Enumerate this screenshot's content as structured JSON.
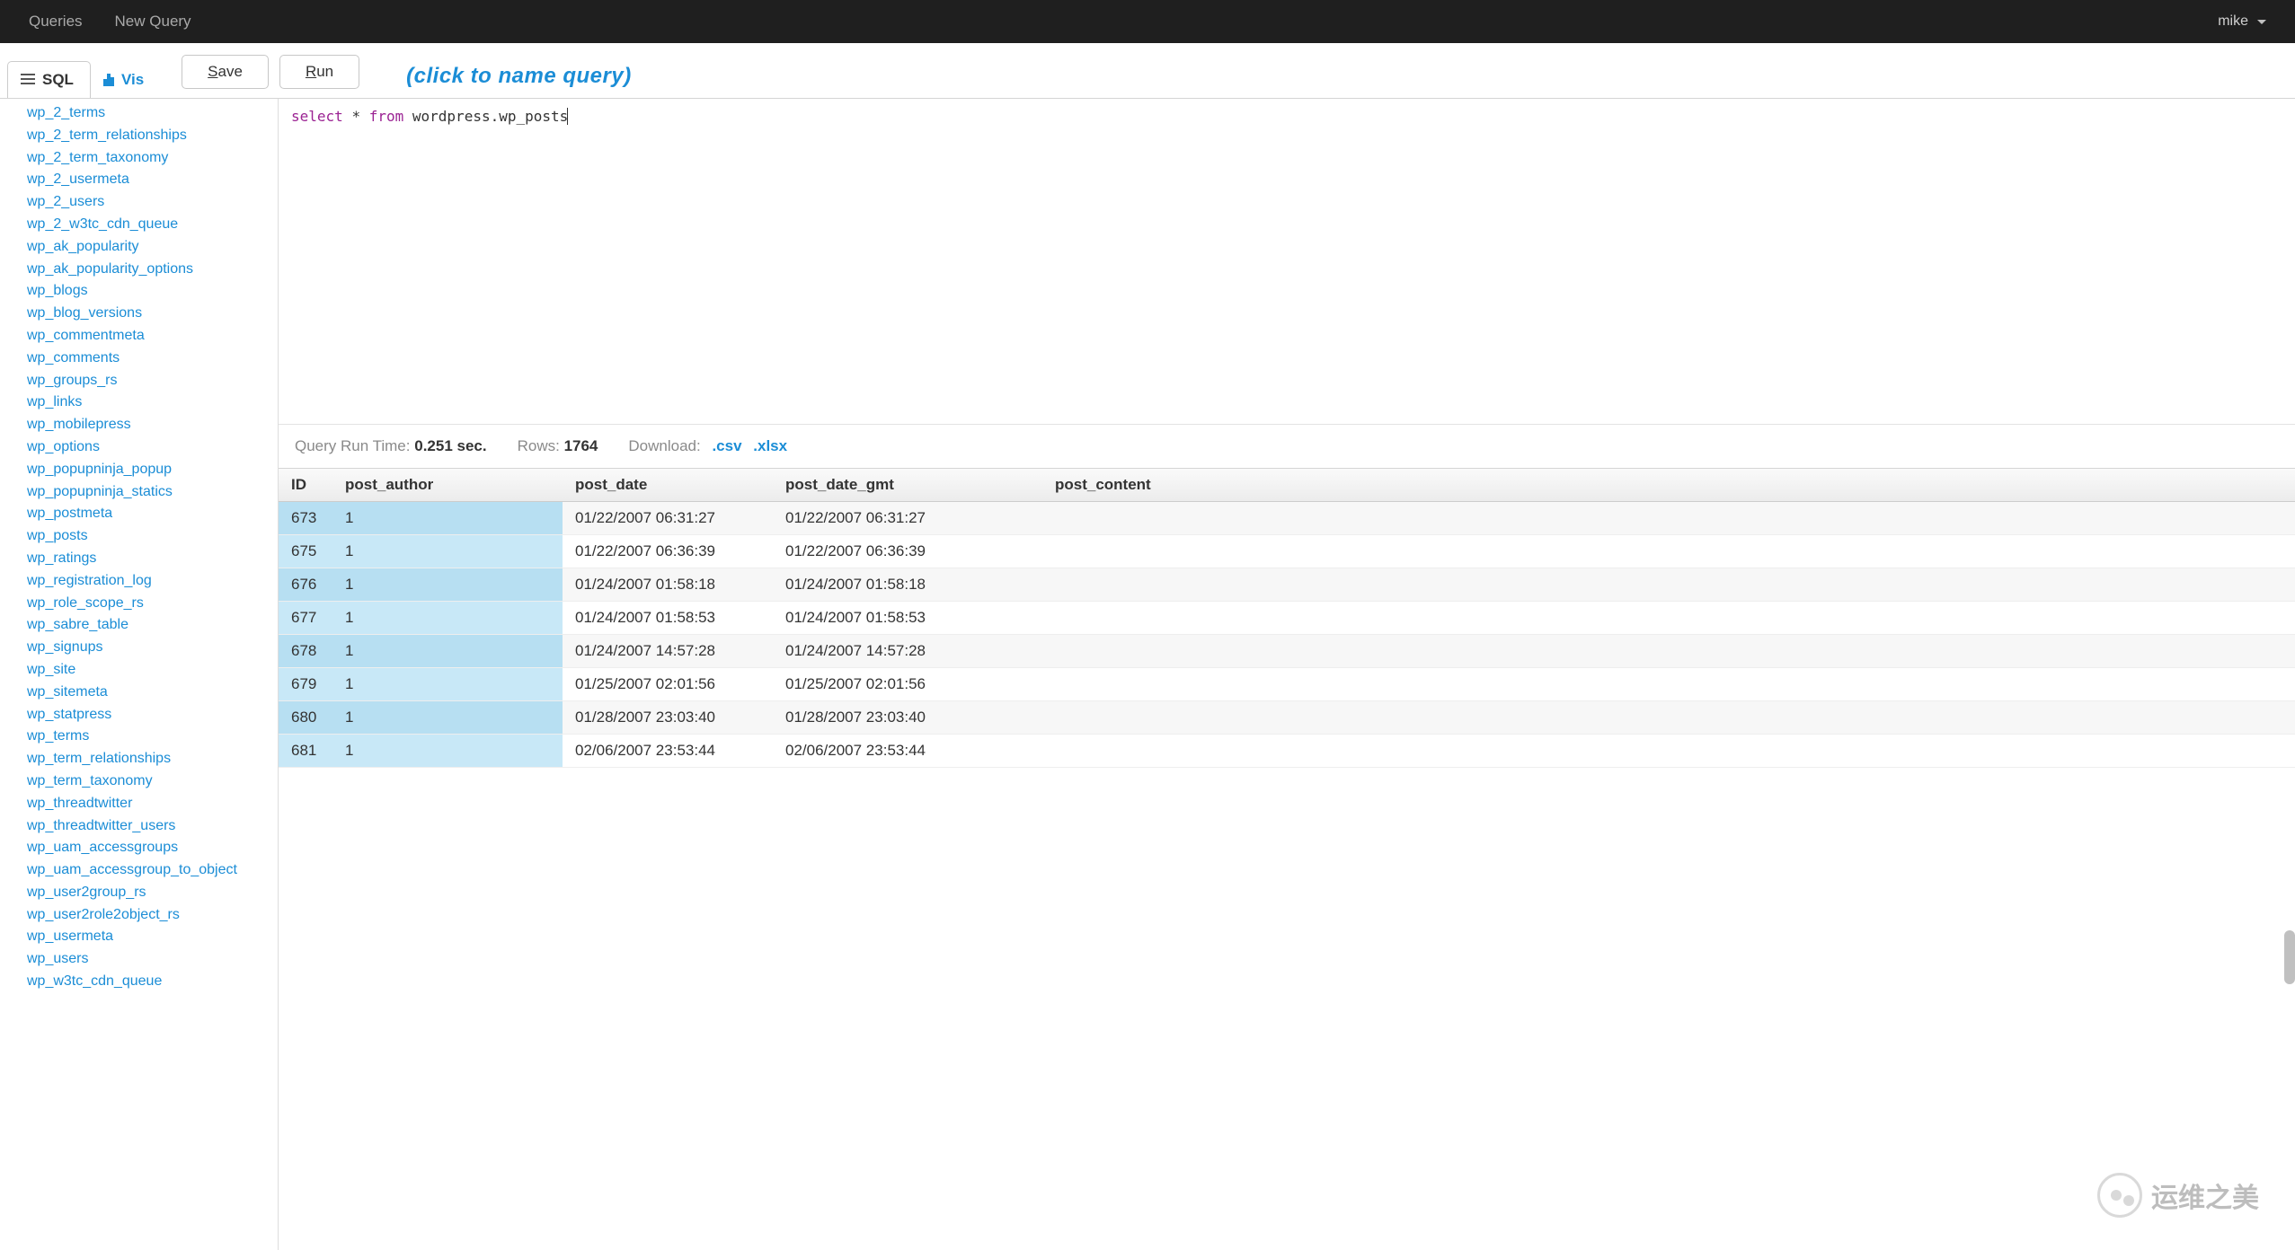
{
  "nav": {
    "queries": "Queries",
    "new_query": "New Query",
    "user": "mike"
  },
  "tabs": {
    "sql": "SQL",
    "vis": "Vis"
  },
  "buttons": {
    "save": "Save",
    "run": "Run",
    "save_ul": "S",
    "save_rest": "ave",
    "run_ul": "R",
    "run_rest": "un"
  },
  "query_name_placeholder": "(click to name query)",
  "editor": {
    "kw1": "select",
    "op": "*",
    "kw2": "from",
    "ident": "wordpress.wp_posts"
  },
  "sidebar": {
    "items": [
      "wp_2_terms",
      "wp_2_term_relationships",
      "wp_2_term_taxonomy",
      "wp_2_usermeta",
      "wp_2_users",
      "wp_2_w3tc_cdn_queue",
      "wp_ak_popularity",
      "wp_ak_popularity_options",
      "wp_blogs",
      "wp_blog_versions",
      "wp_commentmeta",
      "wp_comments",
      "wp_groups_rs",
      "wp_links",
      "wp_mobilepress",
      "wp_options",
      "wp_popupninja_popup",
      "wp_popupninja_statics",
      "wp_postmeta",
      "wp_posts",
      "wp_ratings",
      "wp_registration_log",
      "wp_role_scope_rs",
      "wp_sabre_table",
      "wp_signups",
      "wp_site",
      "wp_sitemeta",
      "wp_statpress",
      "wp_terms",
      "wp_term_relationships",
      "wp_term_taxonomy",
      "wp_threadtwitter",
      "wp_threadtwitter_users",
      "wp_uam_accessgroups",
      "wp_uam_accessgroup_to_object",
      "wp_user2group_rs",
      "wp_user2role2object_rs",
      "wp_usermeta",
      "wp_users",
      "wp_w3tc_cdn_queue"
    ]
  },
  "meta": {
    "runtime_label": "Query Run Time:",
    "runtime_value": "0.251 sec.",
    "rows_label": "Rows:",
    "rows_value": "1764",
    "download_label": "Download:",
    "csv": ".csv",
    "xlsx": ".xlsx"
  },
  "table": {
    "columns": [
      "ID",
      "post_author",
      "post_date",
      "post_date_gmt",
      "post_content"
    ],
    "rows": [
      {
        "id": "673",
        "post_author": "1",
        "post_date": "01/22/2007 06:31:27",
        "post_date_gmt": "01/22/2007 06:31:27",
        "post_content": ""
      },
      {
        "id": "675",
        "post_author": "1",
        "post_date": "01/22/2007 06:36:39",
        "post_date_gmt": "01/22/2007 06:36:39",
        "post_content": ""
      },
      {
        "id": "676",
        "post_author": "1",
        "post_date": "01/24/2007 01:58:18",
        "post_date_gmt": "01/24/2007 01:58:18",
        "post_content": ""
      },
      {
        "id": "677",
        "post_author": "1",
        "post_date": "01/24/2007 01:58:53",
        "post_date_gmt": "01/24/2007 01:58:53",
        "post_content": ""
      },
      {
        "id": "678",
        "post_author": "1",
        "post_date": "01/24/2007 14:57:28",
        "post_date_gmt": "01/24/2007 14:57:28",
        "post_content": ""
      },
      {
        "id": "679",
        "post_author": "1",
        "post_date": "01/25/2007 02:01:56",
        "post_date_gmt": "01/25/2007 02:01:56",
        "post_content": ""
      },
      {
        "id": "680",
        "post_author": "1",
        "post_date": "01/28/2007 23:03:40",
        "post_date_gmt": "01/28/2007 23:03:40",
        "post_content": ""
      },
      {
        "id": "681",
        "post_author": "1",
        "post_date": "02/06/2007 23:53:44",
        "post_date_gmt": "02/06/2007 23:53:44",
        "post_content": ""
      }
    ]
  },
  "watermark": "运维之美"
}
